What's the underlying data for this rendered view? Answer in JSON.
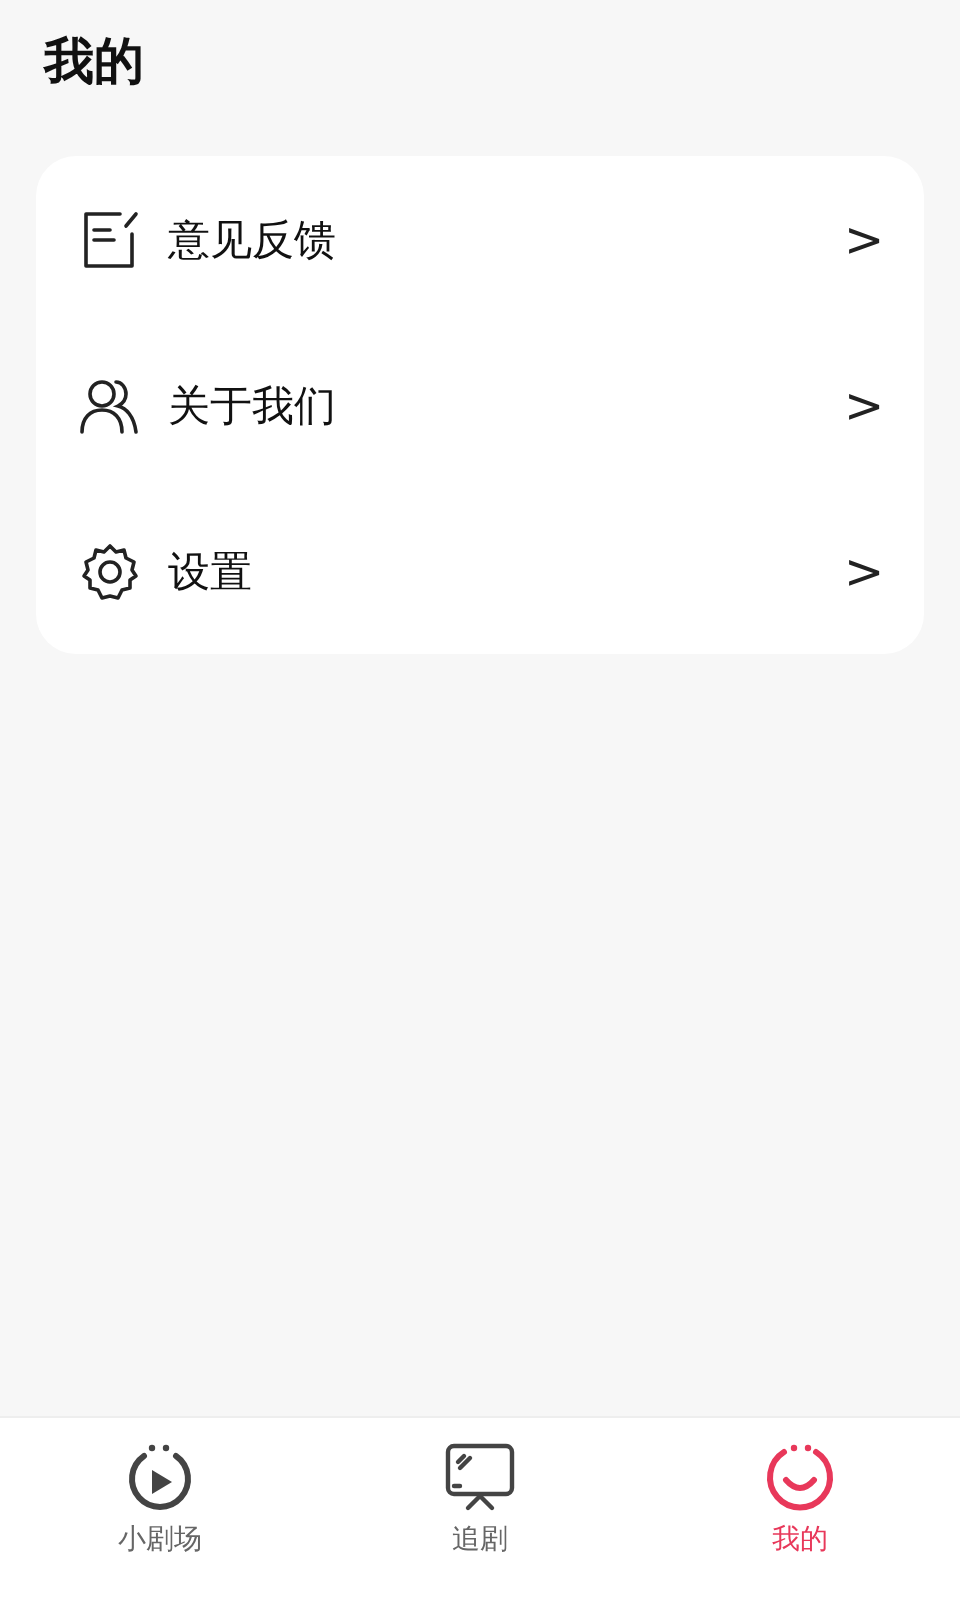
{
  "page_title": "我的",
  "menu_items": [
    {
      "kind": "feedback",
      "label": "意见反馈",
      "chevron": ">"
    },
    {
      "kind": "about",
      "label": "关于我们",
      "chevron": ">"
    },
    {
      "kind": "settings",
      "label": "设置",
      "chevron": ">"
    }
  ],
  "tab_bar": [
    {
      "kind": "play",
      "label": "小剧场",
      "selected": false
    },
    {
      "kind": "tv",
      "label": "追剧",
      "selected": false
    },
    {
      "kind": "smile",
      "label": "我的",
      "selected": true
    }
  ]
}
